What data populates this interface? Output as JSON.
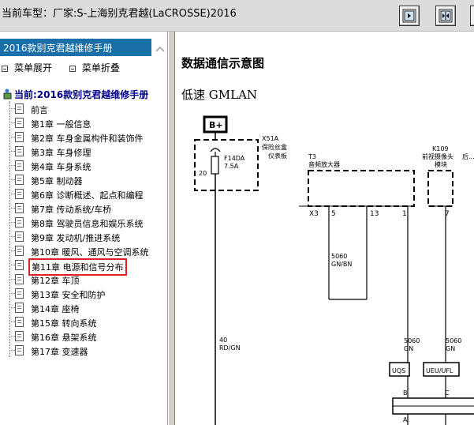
{
  "window": {
    "title": "当前车型：厂家:S-上海别克君越(LaCROSSE)2016"
  },
  "toolbar": {
    "buttons": [
      "expand-right",
      "expand-both",
      "more"
    ]
  },
  "left": {
    "manual_title": "2016款别克君越维修手册",
    "menu_expand": "菜单展开",
    "menu_collapse": "菜单折叠",
    "current": "当前:2016款别克君越维修手册",
    "items": [
      "前言",
      "第1章 一般信息",
      "第2章 车身金属构件和装饰件",
      "第3章 车身修理",
      "第4章 车身系统",
      "第5章 制动器",
      "第6章 诊断概述、起点和编程",
      "第7章 传动系统/车桥",
      "第8章 驾驶员信息和娱乐系统",
      "第9章 发动机/推进系统",
      "第10章 暖风、通风与空调系统",
      "第11章 电源和信号分布",
      "第12章 车顶",
      "第13章 安全和防护",
      "第14章 座椅",
      "第15章 转向系统",
      "第16章 悬架系统",
      "第17章 变速器"
    ],
    "selected_index": 11
  },
  "content": {
    "heading": "数据通信示意图",
    "subheading": "低速 GMLAN",
    "diagram": {
      "battery_label": "B+",
      "fuse_box_id": "X51A",
      "fuse_box_name1": "保险丝盒",
      "fuse_box_name2": "仪表板",
      "fuse_id": "F14DA",
      "fuse_rating": "7.5A",
      "fuse_pin": "20",
      "module1_id": "T3",
      "module1_name": "音频放大器",
      "module1_connector": "X3",
      "module1_pins": [
        "5",
        "13",
        "1"
      ],
      "module2_id": "K109",
      "module2_name1": "前视摄像头",
      "module2_name2": "模块",
      "module2_extra": "后...",
      "module2_pin": "7",
      "wire_gnbn_circuit": "5060",
      "wire_gnbn_color": "GN/BN",
      "wire_rdgn_circuit": "40",
      "wire_rdgn_color": "RD/GN",
      "wire_gn1_circuit": "5060",
      "wire_gn1_color": "GN",
      "wire_gn2_circuit": "5060",
      "wire_gn2_color": "GN",
      "box_uqs": "UQS",
      "box_ueu": "UEU/UFL",
      "pin_b": "B",
      "pin_c": "C",
      "pin_a": "A"
    }
  },
  "colors": {
    "header_blue": "#1b6fa8",
    "tree_root": "#00008b",
    "selected_border": "#e02020"
  }
}
